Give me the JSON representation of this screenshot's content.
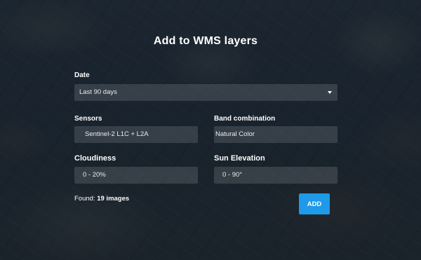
{
  "dialog": {
    "title": "Add to WMS layers"
  },
  "date": {
    "label": "Date",
    "value": "Last 90 days"
  },
  "sensors": {
    "label": "Sensors",
    "value": "Sentinel-2 L1C + L2A"
  },
  "band_combination": {
    "label": "Band combination",
    "value": "Natural Color"
  },
  "cloudiness": {
    "label": "Cloudiness",
    "value": "0 - 20%"
  },
  "sun_elevation": {
    "label": "Sun Elevation",
    "value": "0 - 90°"
  },
  "results": {
    "prefix": "Found: ",
    "count_text": "19 images"
  },
  "actions": {
    "add_label": "ADD"
  },
  "colors": {
    "accent": "#1e9ae8",
    "field_bg": "rgba(255,255,255,0.13)"
  },
  "icons": {
    "date_dropdown": "caret-down-icon"
  }
}
